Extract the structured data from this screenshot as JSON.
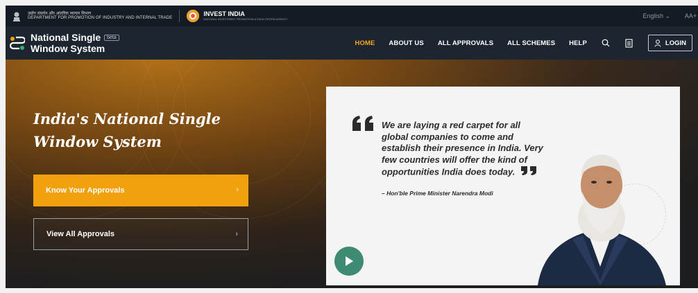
{
  "topbar": {
    "dept_hindi": "उद्योग संवर्धन और आंतरिक व्यापार विभाग",
    "dept_english": "DEPARTMENT FOR PROMOTION OF INDUSTRY AND INTERNAL TRADE",
    "invest_title": "INVEST INDIA",
    "invest_sub": "NATIONAL INVESTMENT PROMOTION & FACILITATION AGENCY",
    "language": "English ⌄",
    "font_size": "AA+"
  },
  "nav": {
    "logo_line1": "National Single",
    "logo_line2": "Window System",
    "beta": "beta",
    "items": [
      "HOME",
      "ABOUT US",
      "ALL APPROVALS",
      "ALL SCHEMES",
      "HELP"
    ],
    "login": "LOGIN"
  },
  "hero": {
    "title": "India's National Single Window System",
    "btn_primary": "Know Your Approvals",
    "btn_secondary": "View All Approvals",
    "chevron": "›"
  },
  "video": {
    "quote": "We are laying a red carpet for all global companies to come and establish their presence in India. Very few countries will offer the kind of opportunities India does today.",
    "author": "– Hon'ble Prime Minister Narendra Modi"
  },
  "colors": {
    "accent": "#f0a10d",
    "nav_bg": "#1c2530",
    "play": "#3f8a72"
  }
}
